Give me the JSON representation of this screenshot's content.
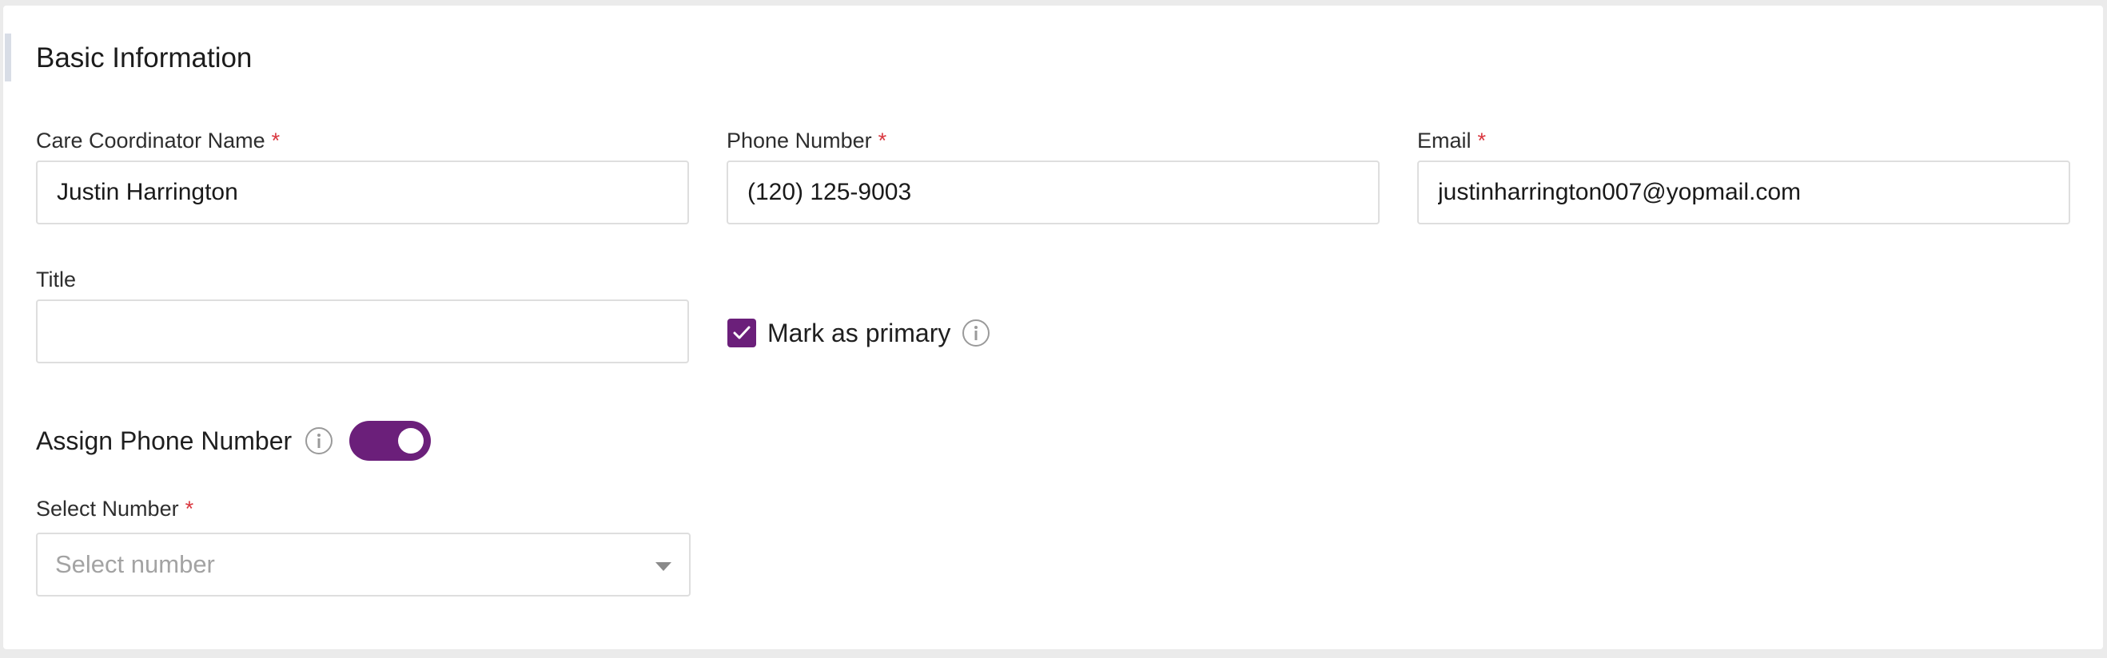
{
  "section": {
    "title": "Basic Information"
  },
  "fields": {
    "coordinator_name": {
      "label": "Care Coordinator Name",
      "required_mark": "*",
      "value": "Justin Harrington"
    },
    "phone_number": {
      "label": "Phone Number",
      "required_mark": "*",
      "value": "(120) 125-9003"
    },
    "email": {
      "label": "Email",
      "required_mark": "*",
      "value": "justinharrington007@yopmail.com"
    },
    "title": {
      "label": "Title",
      "value": ""
    }
  },
  "mark_primary": {
    "label": "Mark as primary",
    "checked": true,
    "icon": "info-icon"
  },
  "assign_phone": {
    "label": "Assign Phone Number",
    "enabled": true,
    "icon": "info-icon"
  },
  "select_number": {
    "label": "Select Number",
    "required_mark": "*",
    "placeholder": "Select number"
  },
  "colors": {
    "accent": "#6b1f7a",
    "required": "#d9363e",
    "border": "#dedede",
    "placeholder": "#a3a3a3"
  }
}
